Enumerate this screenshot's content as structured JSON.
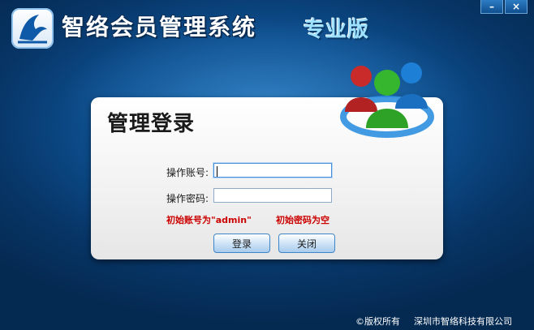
{
  "window": {
    "minimize_label": "–",
    "close_label": "×"
  },
  "header": {
    "app_title": "智络会员管理系统",
    "edition": "专业版"
  },
  "login": {
    "title": "管理登录",
    "account_label": "操作账号:",
    "account_value": "",
    "password_label": "操作密码:",
    "password_value": "",
    "hint_account": "初始账号为\"admin\"",
    "hint_password": "初始密码为空",
    "login_button": "登录",
    "close_button": "关闭"
  },
  "footer": {
    "copyright": "©版权所有",
    "company": "深圳市智络科技有限公司"
  },
  "colors": {
    "background": "#0d4f8f",
    "hint": "#cc0000",
    "button_border": "#3f86c8"
  }
}
